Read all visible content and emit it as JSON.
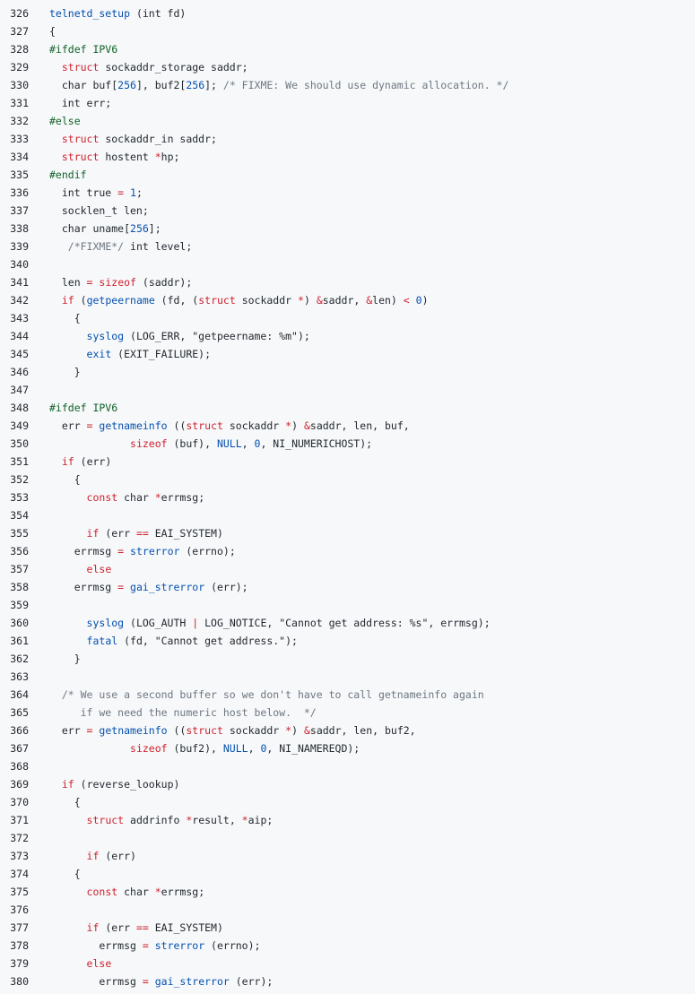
{
  "colors": {
    "background": "#f6f8fa",
    "default_text": "#24292f",
    "keyword": "#cf222e",
    "preprocessor": "#116329",
    "function": "#0550ae",
    "number": "#0550ae",
    "comment": "#6e7781",
    "string": "#0a3069",
    "operator": "#cf222e"
  },
  "lines": [
    {
      "n": "326",
      "t": [
        [
          "fn",
          "telnetd_setup"
        ],
        [
          "id",
          " (int fd)"
        ]
      ]
    },
    {
      "n": "327",
      "t": [
        [
          "id",
          "{"
        ]
      ]
    },
    {
      "n": "328",
      "t": [
        [
          "pp",
          "#ifdef IPV6"
        ]
      ]
    },
    {
      "n": "329",
      "t": [
        [
          "id",
          "  "
        ],
        [
          "kw",
          "struct"
        ],
        [
          "id",
          " sockaddr_storage saddr;"
        ]
      ]
    },
    {
      "n": "330",
      "t": [
        [
          "id",
          "  char buf["
        ],
        [
          "num",
          "256"
        ],
        [
          "id",
          "], buf2["
        ],
        [
          "num",
          "256"
        ],
        [
          "id",
          "]; "
        ],
        [
          "cm",
          "/* FIXME: We should use dynamic allocation. */"
        ]
      ]
    },
    {
      "n": "331",
      "t": [
        [
          "id",
          "  int err;"
        ]
      ]
    },
    {
      "n": "332",
      "t": [
        [
          "pp",
          "#else"
        ]
      ]
    },
    {
      "n": "333",
      "t": [
        [
          "id",
          "  "
        ],
        [
          "kw",
          "struct"
        ],
        [
          "id",
          " sockaddr_in saddr;"
        ]
      ]
    },
    {
      "n": "334",
      "t": [
        [
          "id",
          "  "
        ],
        [
          "kw",
          "struct"
        ],
        [
          "id",
          " hostent "
        ],
        [
          "op",
          "*"
        ],
        [
          "id",
          "hp;"
        ]
      ]
    },
    {
      "n": "335",
      "t": [
        [
          "pp",
          "#endif"
        ]
      ]
    },
    {
      "n": "336",
      "t": [
        [
          "id",
          "  int true "
        ],
        [
          "op",
          "="
        ],
        [
          "id",
          " "
        ],
        [
          "num",
          "1"
        ],
        [
          "id",
          ";"
        ]
      ]
    },
    {
      "n": "337",
      "t": [
        [
          "id",
          "  socklen_t len;"
        ]
      ]
    },
    {
      "n": "338",
      "t": [
        [
          "id",
          "  char uname["
        ],
        [
          "num",
          "256"
        ],
        [
          "id",
          "];"
        ]
      ]
    },
    {
      "n": "339",
      "t": [
        [
          "id",
          "   "
        ],
        [
          "cm",
          "/*FIXME*/"
        ],
        [
          "id",
          " int level;"
        ]
      ]
    },
    {
      "n": "340",
      "t": []
    },
    {
      "n": "341",
      "t": [
        [
          "id",
          "  len "
        ],
        [
          "op",
          "="
        ],
        [
          "id",
          " "
        ],
        [
          "kw",
          "sizeof"
        ],
        [
          "id",
          " (saddr);"
        ]
      ]
    },
    {
      "n": "342",
      "t": [
        [
          "id",
          "  "
        ],
        [
          "kw",
          "if"
        ],
        [
          "id",
          " ("
        ],
        [
          "fn",
          "getpeername"
        ],
        [
          "id",
          " (fd, ("
        ],
        [
          "kw",
          "struct"
        ],
        [
          "id",
          " sockaddr "
        ],
        [
          "op",
          "*"
        ],
        [
          "id",
          ") "
        ],
        [
          "op",
          "&"
        ],
        [
          "id",
          "saddr, "
        ],
        [
          "op",
          "&"
        ],
        [
          "id",
          "len) "
        ],
        [
          "op",
          "<"
        ],
        [
          "id",
          " "
        ],
        [
          "num",
          "0"
        ],
        [
          "id",
          ")"
        ]
      ]
    },
    {
      "n": "343",
      "t": [
        [
          "id",
          "    {"
        ]
      ]
    },
    {
      "n": "344",
      "t": [
        [
          "id",
          "      "
        ],
        [
          "fn",
          "syslog"
        ],
        [
          "id",
          " (LOG_ERR, \"getpeername: %m\");"
        ]
      ]
    },
    {
      "n": "345",
      "t": [
        [
          "id",
          "      "
        ],
        [
          "fn",
          "exit"
        ],
        [
          "id",
          " (EXIT_FAILURE);"
        ]
      ]
    },
    {
      "n": "346",
      "t": [
        [
          "id",
          "    }"
        ]
      ]
    },
    {
      "n": "347",
      "t": []
    },
    {
      "n": "348",
      "t": [
        [
          "pp",
          "#ifdef IPV6"
        ]
      ]
    },
    {
      "n": "349",
      "t": [
        [
          "id",
          "  err "
        ],
        [
          "op",
          "="
        ],
        [
          "id",
          " "
        ],
        [
          "fn",
          "getnameinfo"
        ],
        [
          "id",
          " (("
        ],
        [
          "kw",
          "struct"
        ],
        [
          "id",
          " sockaddr "
        ],
        [
          "op",
          "*"
        ],
        [
          "id",
          ") "
        ],
        [
          "op",
          "&"
        ],
        [
          "id",
          "saddr, len, buf,"
        ]
      ]
    },
    {
      "n": "350",
      "t": [
        [
          "id",
          "             "
        ],
        [
          "kw",
          "sizeof"
        ],
        [
          "id",
          " (buf), "
        ],
        [
          "fn",
          "NULL"
        ],
        [
          "id",
          ", "
        ],
        [
          "num",
          "0"
        ],
        [
          "id",
          ", NI_NUMERICHOST);"
        ]
      ]
    },
    {
      "n": "351",
      "t": [
        [
          "id",
          "  "
        ],
        [
          "kw",
          "if"
        ],
        [
          "id",
          " (err)"
        ]
      ]
    },
    {
      "n": "352",
      "t": [
        [
          "id",
          "    {"
        ]
      ]
    },
    {
      "n": "353",
      "t": [
        [
          "id",
          "      "
        ],
        [
          "kw",
          "const"
        ],
        [
          "id",
          " char "
        ],
        [
          "op",
          "*"
        ],
        [
          "id",
          "errmsg;"
        ]
      ]
    },
    {
      "n": "354",
      "t": []
    },
    {
      "n": "355",
      "t": [
        [
          "id",
          "      "
        ],
        [
          "kw",
          "if"
        ],
        [
          "id",
          " (err "
        ],
        [
          "op",
          "=="
        ],
        [
          "id",
          " EAI_SYSTEM)"
        ]
      ]
    },
    {
      "n": "356",
      "t": [
        [
          "id",
          "    errmsg "
        ],
        [
          "op",
          "="
        ],
        [
          "id",
          " "
        ],
        [
          "fn",
          "strerror"
        ],
        [
          "id",
          " (errno);"
        ]
      ]
    },
    {
      "n": "357",
      "t": [
        [
          "id",
          "      "
        ],
        [
          "kw",
          "else"
        ]
      ]
    },
    {
      "n": "358",
      "t": [
        [
          "id",
          "    errmsg "
        ],
        [
          "op",
          "="
        ],
        [
          "id",
          " "
        ],
        [
          "fn",
          "gai_strerror"
        ],
        [
          "id",
          " (err);"
        ]
      ]
    },
    {
      "n": "359",
      "t": []
    },
    {
      "n": "360",
      "t": [
        [
          "id",
          "      "
        ],
        [
          "fn",
          "syslog"
        ],
        [
          "id",
          " (LOG_AUTH "
        ],
        [
          "op",
          "|"
        ],
        [
          "id",
          " LOG_NOTICE, \"Cannot get address: %s\", errmsg);"
        ]
      ]
    },
    {
      "n": "361",
      "t": [
        [
          "id",
          "      "
        ],
        [
          "fn",
          "fatal"
        ],
        [
          "id",
          " (fd, \"Cannot get address.\");"
        ]
      ]
    },
    {
      "n": "362",
      "t": [
        [
          "id",
          "    }"
        ]
      ]
    },
    {
      "n": "363",
      "t": []
    },
    {
      "n": "364",
      "t": [
        [
          "id",
          "  "
        ],
        [
          "cm",
          "/* We use a second buffer so we don't have to call getnameinfo again"
        ]
      ]
    },
    {
      "n": "365",
      "t": [
        [
          "cm",
          "     if we need the numeric host below.  */"
        ]
      ]
    },
    {
      "n": "366",
      "t": [
        [
          "id",
          "  err "
        ],
        [
          "op",
          "="
        ],
        [
          "id",
          " "
        ],
        [
          "fn",
          "getnameinfo"
        ],
        [
          "id",
          " (("
        ],
        [
          "kw",
          "struct"
        ],
        [
          "id",
          " sockaddr "
        ],
        [
          "op",
          "*"
        ],
        [
          "id",
          ") "
        ],
        [
          "op",
          "&"
        ],
        [
          "id",
          "saddr, len, buf2,"
        ]
      ]
    },
    {
      "n": "367",
      "t": [
        [
          "id",
          "             "
        ],
        [
          "kw",
          "sizeof"
        ],
        [
          "id",
          " (buf2), "
        ],
        [
          "fn",
          "NULL"
        ],
        [
          "id",
          ", "
        ],
        [
          "num",
          "0"
        ],
        [
          "id",
          ", NI_NAMEREQD);"
        ]
      ]
    },
    {
      "n": "368",
      "t": []
    },
    {
      "n": "369",
      "t": [
        [
          "id",
          "  "
        ],
        [
          "kw",
          "if"
        ],
        [
          "id",
          " (reverse_lookup)"
        ]
      ]
    },
    {
      "n": "370",
      "t": [
        [
          "id",
          "    {"
        ]
      ]
    },
    {
      "n": "371",
      "t": [
        [
          "id",
          "      "
        ],
        [
          "kw",
          "struct"
        ],
        [
          "id",
          " addrinfo "
        ],
        [
          "op",
          "*"
        ],
        [
          "id",
          "result, "
        ],
        [
          "op",
          "*"
        ],
        [
          "id",
          "aip;"
        ]
      ]
    },
    {
      "n": "372",
      "t": []
    },
    {
      "n": "373",
      "t": [
        [
          "id",
          "      "
        ],
        [
          "kw",
          "if"
        ],
        [
          "id",
          " (err)"
        ]
      ]
    },
    {
      "n": "374",
      "t": [
        [
          "id",
          "    {"
        ]
      ]
    },
    {
      "n": "375",
      "t": [
        [
          "id",
          "      "
        ],
        [
          "kw",
          "const"
        ],
        [
          "id",
          " char "
        ],
        [
          "op",
          "*"
        ],
        [
          "id",
          "errmsg;"
        ]
      ]
    },
    {
      "n": "376",
      "t": []
    },
    {
      "n": "377",
      "t": [
        [
          "id",
          "      "
        ],
        [
          "kw",
          "if"
        ],
        [
          "id",
          " (err "
        ],
        [
          "op",
          "=="
        ],
        [
          "id",
          " EAI_SYSTEM)"
        ]
      ]
    },
    {
      "n": "378",
      "t": [
        [
          "id",
          "        errmsg "
        ],
        [
          "op",
          "="
        ],
        [
          "id",
          " "
        ],
        [
          "fn",
          "strerror"
        ],
        [
          "id",
          " (errno);"
        ]
      ]
    },
    {
      "n": "379",
      "t": [
        [
          "id",
          "      "
        ],
        [
          "kw",
          "else"
        ]
      ]
    },
    {
      "n": "380",
      "t": [
        [
          "id",
          "        errmsg "
        ],
        [
          "op",
          "="
        ],
        [
          "id",
          " "
        ],
        [
          "fn",
          "gai_strerror"
        ],
        [
          "id",
          " (err);"
        ]
      ]
    }
  ]
}
